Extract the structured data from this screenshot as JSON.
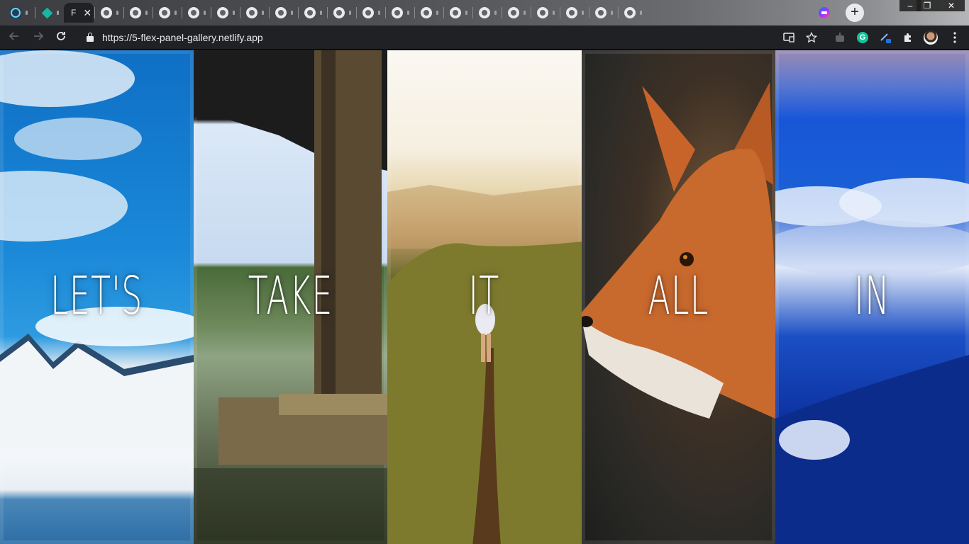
{
  "browser": {
    "active_tab": {
      "title": "F",
      "close": "✕"
    },
    "tabs_count": 24,
    "new_tab_label": "+",
    "window_controls": {
      "minimize": "–",
      "restore": "❐",
      "close": "✕"
    },
    "url": "https://5-flex-panel-gallery.netlify.app",
    "grammarly_label": "G"
  },
  "gallery": {
    "panels": [
      {
        "word": "LET'S",
        "scene": "snowy mountains under blue sky"
      },
      {
        "word": "TAKE",
        "scene": "wooden dock over lake"
      },
      {
        "word": "IT",
        "scene": "hiker on grassy ridge"
      },
      {
        "word": "ALL",
        "scene": "red fox portrait"
      },
      {
        "word": "IN",
        "scene": "blue sky with clouds"
      }
    ]
  },
  "colors": {
    "toolbar_bg": "#202124",
    "text": "#e8eaed",
    "panel_text": "#ffffff"
  }
}
